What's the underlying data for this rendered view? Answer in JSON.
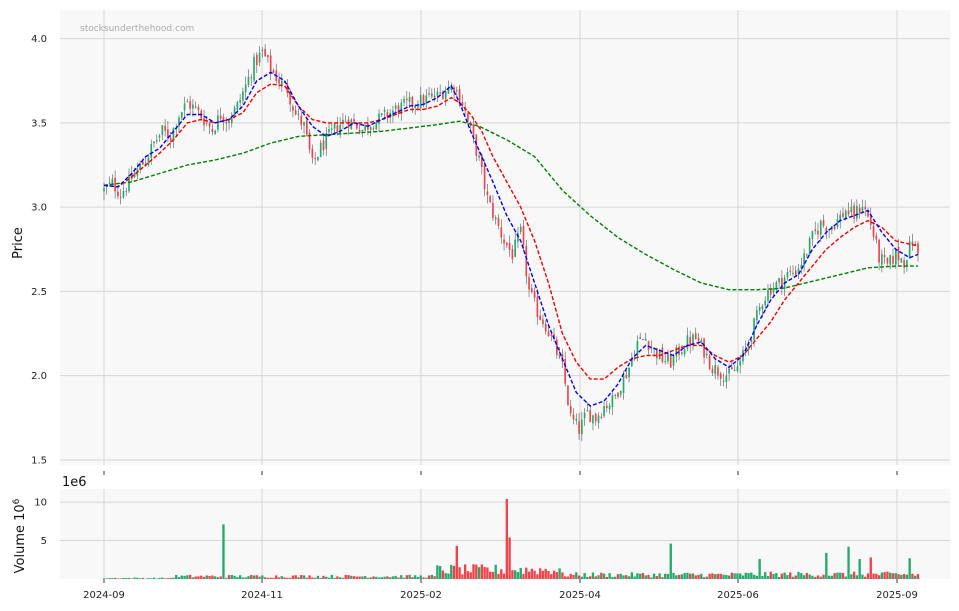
{
  "watermark": "stocksunderthehood.com",
  "colors": {
    "up": "#26a96c",
    "down": "#f0434a",
    "ma_fast": "#0000ee",
    "ma_mid": "#ee0000",
    "ma_slow": "#008000",
    "panel_bg": "#f8f8f8",
    "grid": "#d6d6d6"
  },
  "chart_data": [
    {
      "type": "candlestick",
      "ylabel": "Price",
      "ylim": [
        1.47,
        4.17
      ],
      "yticks": [
        "1.5",
        "2.0",
        "2.5",
        "3.0",
        "3.5",
        "4.0"
      ],
      "xticks": [
        "2024-09",
        "2024-11",
        "2025-02",
        "2025-04",
        "2025-06",
        "2025-09"
      ],
      "grid": true,
      "series": [
        {
          "kind": "candles",
          "note": "daily OHLC"
        },
        {
          "kind": "moving-average",
          "style": "dashed",
          "color_key": "ma_fast"
        },
        {
          "kind": "moving-average",
          "style": "dashed",
          "color_key": "ma_mid"
        },
        {
          "kind": "moving-average",
          "style": "dashed",
          "color_key": "ma_slow"
        }
      ],
      "close_path": [
        [
          0,
          3.1
        ],
        [
          3,
          3.14
        ],
        [
          6,
          3.08
        ],
        [
          9,
          3.15
        ],
        [
          12,
          3.22
        ],
        [
          15,
          3.28
        ],
        [
          18,
          3.38
        ],
        [
          21,
          3.45
        ],
        [
          24,
          3.42
        ],
        [
          27,
          3.55
        ],
        [
          30,
          3.62
        ],
        [
          33,
          3.58
        ],
        [
          36,
          3.52
        ],
        [
          39,
          3.46
        ],
        [
          42,
          3.55
        ],
        [
          45,
          3.52
        ],
        [
          48,
          3.6
        ],
        [
          51,
          3.72
        ],
        [
          54,
          3.85
        ],
        [
          57,
          3.92
        ],
        [
          60,
          3.82
        ],
        [
          63,
          3.75
        ],
        [
          66,
          3.7
        ],
        [
          69,
          3.55
        ],
        [
          72,
          3.48
        ],
        [
          75,
          3.25
        ],
        [
          78,
          3.35
        ],
        [
          81,
          3.42
        ],
        [
          84,
          3.48
        ],
        [
          87,
          3.52
        ],
        [
          90,
          3.5
        ],
        [
          93,
          3.46
        ],
        [
          96,
          3.5
        ],
        [
          99,
          3.52
        ],
        [
          102,
          3.55
        ],
        [
          105,
          3.58
        ],
        [
          108,
          3.6
        ],
        [
          111,
          3.62
        ],
        [
          114,
          3.63
        ],
        [
          117,
          3.65
        ],
        [
          120,
          3.66
        ],
        [
          123,
          3.7
        ],
        [
          126,
          3.72
        ],
        [
          129,
          3.62
        ],
        [
          132,
          3.45
        ],
        [
          135,
          3.28
        ],
        [
          138,
          3.05
        ],
        [
          141,
          2.92
        ],
        [
          144,
          2.8
        ],
        [
          147,
          2.72
        ],
        [
          150,
          2.85
        ],
        [
          153,
          2.5
        ],
        [
          156,
          2.38
        ],
        [
          159,
          2.3
        ],
        [
          162,
          2.18
        ],
        [
          165,
          2.05
        ],
        [
          168,
          1.75
        ],
        [
          171,
          1.68
        ],
        [
          174,
          1.78
        ],
        [
          177,
          1.75
        ],
        [
          180,
          1.82
        ],
        [
          183,
          1.85
        ],
        [
          186,
          1.95
        ],
        [
          189,
          2.05
        ],
        [
          192,
          2.2
        ],
        [
          195,
          2.22
        ],
        [
          198,
          2.15
        ],
        [
          201,
          2.1
        ],
        [
          204,
          2.08
        ],
        [
          207,
          2.15
        ],
        [
          210,
          2.2
        ],
        [
          213,
          2.22
        ],
        [
          216,
          2.15
        ],
        [
          219,
          2.05
        ],
        [
          222,
          2.02
        ],
        [
          225,
          2.0
        ],
        [
          228,
          2.05
        ],
        [
          231,
          2.15
        ],
        [
          234,
          2.3
        ],
        [
          237,
          2.45
        ],
        [
          240,
          2.52
        ],
        [
          243,
          2.55
        ],
        [
          246,
          2.6
        ],
        [
          249,
          2.62
        ],
        [
          252,
          2.7
        ],
        [
          255,
          2.82
        ],
        [
          258,
          2.9
        ],
        [
          261,
          2.88
        ],
        [
          264,
          2.92
        ],
        [
          267,
          2.98
        ],
        [
          270,
          2.95
        ],
        [
          273,
          3.02
        ],
        [
          276,
          2.9
        ],
        [
          279,
          2.7
        ],
        [
          282,
          2.65
        ],
        [
          285,
          2.72
        ],
        [
          288,
          2.68
        ],
        [
          291,
          2.8
        ],
        [
          293,
          2.72
        ]
      ],
      "ma_fast": [
        [
          0,
          3.13
        ],
        [
          5,
          3.12
        ],
        [
          10,
          3.2
        ],
        [
          15,
          3.3
        ],
        [
          20,
          3.35
        ],
        [
          25,
          3.45
        ],
        [
          30,
          3.55
        ],
        [
          35,
          3.55
        ],
        [
          40,
          3.5
        ],
        [
          45,
          3.52
        ],
        [
          50,
          3.6
        ],
        [
          55,
          3.75
        ],
        [
          60,
          3.8
        ],
        [
          65,
          3.75
        ],
        [
          70,
          3.6
        ],
        [
          75,
          3.48
        ],
        [
          80,
          3.42
        ],
        [
          85,
          3.45
        ],
        [
          90,
          3.5
        ],
        [
          95,
          3.48
        ],
        [
          100,
          3.52
        ],
        [
          105,
          3.56
        ],
        [
          110,
          3.6
        ],
        [
          115,
          3.61
        ],
        [
          120,
          3.65
        ],
        [
          125,
          3.72
        ],
        [
          128,
          3.62
        ],
        [
          132,
          3.45
        ],
        [
          136,
          3.3
        ],
        [
          140,
          3.15
        ],
        [
          145,
          2.95
        ],
        [
          150,
          2.8
        ],
        [
          155,
          2.55
        ],
        [
          160,
          2.3
        ],
        [
          165,
          2.1
        ],
        [
          170,
          1.9
        ],
        [
          175,
          1.82
        ],
        [
          180,
          1.85
        ],
        [
          185,
          1.95
        ],
        [
          190,
          2.1
        ],
        [
          195,
          2.18
        ],
        [
          200,
          2.15
        ],
        [
          205,
          2.12
        ],
        [
          210,
          2.18
        ],
        [
          215,
          2.2
        ],
        [
          220,
          2.1
        ],
        [
          225,
          2.05
        ],
        [
          230,
          2.12
        ],
        [
          235,
          2.3
        ],
        [
          240,
          2.45
        ],
        [
          245,
          2.55
        ],
        [
          250,
          2.6
        ],
        [
          255,
          2.75
        ],
        [
          260,
          2.85
        ],
        [
          265,
          2.92
        ],
        [
          270,
          2.95
        ],
        [
          275,
          2.98
        ],
        [
          280,
          2.85
        ],
        [
          285,
          2.75
        ],
        [
          290,
          2.7
        ],
        [
          293,
          2.72
        ]
      ],
      "ma_mid": [
        [
          0,
          3.13
        ],
        [
          5,
          3.12
        ],
        [
          10,
          3.18
        ],
        [
          15,
          3.25
        ],
        [
          20,
          3.32
        ],
        [
          25,
          3.4
        ],
        [
          30,
          3.5
        ],
        [
          35,
          3.52
        ],
        [
          40,
          3.5
        ],
        [
          45,
          3.52
        ],
        [
          50,
          3.56
        ],
        [
          55,
          3.68
        ],
        [
          60,
          3.73
        ],
        [
          65,
          3.72
        ],
        [
          70,
          3.6
        ],
        [
          75,
          3.52
        ],
        [
          80,
          3.5
        ],
        [
          85,
          3.5
        ],
        [
          90,
          3.5
        ],
        [
          95,
          3.5
        ],
        [
          100,
          3.52
        ],
        [
          105,
          3.55
        ],
        [
          110,
          3.58
        ],
        [
          115,
          3.58
        ],
        [
          120,
          3.6
        ],
        [
          125,
          3.65
        ],
        [
          128,
          3.62
        ],
        [
          132,
          3.55
        ],
        [
          136,
          3.45
        ],
        [
          140,
          3.3
        ],
        [
          145,
          3.15
        ],
        [
          150,
          3.0
        ],
        [
          155,
          2.8
        ],
        [
          160,
          2.55
        ],
        [
          165,
          2.25
        ],
        [
          170,
          2.08
        ],
        [
          175,
          1.98
        ],
        [
          180,
          1.98
        ],
        [
          185,
          2.05
        ],
        [
          190,
          2.1
        ],
        [
          195,
          2.12
        ],
        [
          200,
          2.12
        ],
        [
          205,
          2.15
        ],
        [
          210,
          2.18
        ],
        [
          215,
          2.18
        ],
        [
          220,
          2.12
        ],
        [
          225,
          2.08
        ],
        [
          230,
          2.12
        ],
        [
          235,
          2.22
        ],
        [
          240,
          2.32
        ],
        [
          245,
          2.45
        ],
        [
          250,
          2.55
        ],
        [
          255,
          2.65
        ],
        [
          260,
          2.75
        ],
        [
          265,
          2.82
        ],
        [
          270,
          2.88
        ],
        [
          275,
          2.92
        ],
        [
          280,
          2.88
        ],
        [
          285,
          2.8
        ],
        [
          290,
          2.78
        ],
        [
          293,
          2.77
        ]
      ],
      "ma_slow": [
        [
          0,
          3.13
        ],
        [
          10,
          3.15
        ],
        [
          20,
          3.2
        ],
        [
          30,
          3.25
        ],
        [
          40,
          3.28
        ],
        [
          50,
          3.32
        ],
        [
          60,
          3.38
        ],
        [
          70,
          3.42
        ],
        [
          80,
          3.43
        ],
        [
          90,
          3.44
        ],
        [
          100,
          3.45
        ],
        [
          110,
          3.47
        ],
        [
          120,
          3.49
        ],
        [
          128,
          3.51
        ],
        [
          135,
          3.48
        ],
        [
          145,
          3.4
        ],
        [
          155,
          3.3
        ],
        [
          165,
          3.1
        ],
        [
          175,
          2.95
        ],
        [
          185,
          2.82
        ],
        [
          195,
          2.72
        ],
        [
          205,
          2.63
        ],
        [
          215,
          2.55
        ],
        [
          225,
          2.51
        ],
        [
          235,
          2.51
        ],
        [
          245,
          2.52
        ],
        [
          255,
          2.56
        ],
        [
          265,
          2.6
        ],
        [
          275,
          2.64
        ],
        [
          285,
          2.65
        ],
        [
          293,
          2.65
        ]
      ]
    },
    {
      "type": "bar",
      "ylabel": "Volume  10",
      "ylabel_sup": "6",
      "offset_label": "1e6",
      "ylim": [
        0,
        11.7
      ],
      "yticks": [
        "5",
        "10"
      ],
      "units": "millions of shares (approx.)",
      "spikes": [
        {
          "day": 43,
          "value": 7.1,
          "up": true
        },
        {
          "day": 127,
          "value": 4.3,
          "up": false
        },
        {
          "day": 145,
          "value": 10.4,
          "up": false
        },
        {
          "day": 146,
          "value": 5.4,
          "up": false
        },
        {
          "day": 204,
          "value": 4.6,
          "up": true
        },
        {
          "day": 236,
          "value": 2.6,
          "up": true
        },
        {
          "day": 260,
          "value": 3.4,
          "up": true
        },
        {
          "day": 268,
          "value": 4.2,
          "up": true
        },
        {
          "day": 272,
          "value": 2.6,
          "up": true
        },
        {
          "day": 276,
          "value": 2.8,
          "up": false
        },
        {
          "day": 290,
          "value": 2.7,
          "up": true
        }
      ]
    }
  ]
}
